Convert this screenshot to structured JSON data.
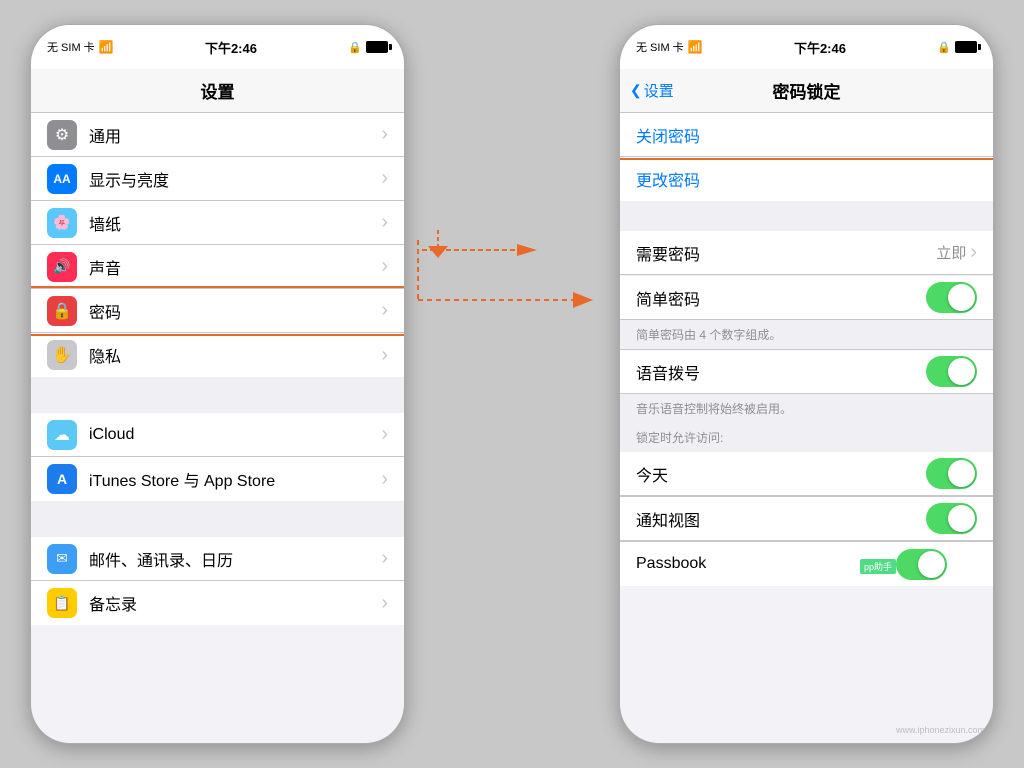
{
  "left_phone": {
    "status": {
      "signal": "无 SIM 卡",
      "wifi": "WiFi",
      "time": "下午2:46"
    },
    "nav": {
      "title": "设置"
    },
    "sections": [
      {
        "items": [
          {
            "icon": "gear",
            "icon_color": "ic-gray",
            "label": "通用",
            "id": "general"
          },
          {
            "icon": "AA",
            "icon_color": "ic-blue",
            "label": "显示与亮度",
            "id": "display"
          },
          {
            "icon": "🌸",
            "icon_color": "ic-teal",
            "label": "墙纸",
            "id": "wallpaper"
          },
          {
            "icon": "🔊",
            "icon_color": "ic-pink",
            "label": "声音",
            "id": "sound"
          },
          {
            "icon": "🔒",
            "icon_color": "ic-red",
            "label": "密码",
            "id": "passcode",
            "highlighted": true
          },
          {
            "icon": "✋",
            "icon_color": "ic-light-gray",
            "label": "隐私",
            "id": "privacy"
          }
        ]
      },
      {
        "items": [
          {
            "icon": "☁",
            "icon_color": "ic-icloud",
            "label": "iCloud",
            "id": "icloud"
          },
          {
            "icon": "A",
            "icon_color": "ic-store",
            "label": "iTunes Store 与 App Store",
            "id": "store"
          }
        ]
      },
      {
        "items": [
          {
            "icon": "✉",
            "icon_color": "ic-mail",
            "label": "邮件、通讯录、日历",
            "id": "mail"
          },
          {
            "icon": "📋",
            "icon_color": "ic-notes",
            "label": "备忘录",
            "id": "notes"
          }
        ]
      }
    ]
  },
  "right_phone": {
    "status": {
      "signal": "无 SIM 卡",
      "wifi": "WiFi",
      "time": "下午2:46"
    },
    "nav": {
      "title": "密码锁定",
      "back": "设置"
    },
    "top_section": [
      {
        "label": "关闭密码",
        "highlighted": true
      },
      {
        "label": "更改密码"
      }
    ],
    "rows": [
      {
        "type": "navigate",
        "label": "需要密码",
        "value": "立即",
        "id": "require-passcode"
      },
      {
        "type": "toggle",
        "label": "简单密码",
        "enabled": true,
        "id": "simple-passcode"
      },
      {
        "type": "sub-text",
        "text": "简单密码由 4 个数字组成。"
      },
      {
        "type": "toggle",
        "label": "语音拨号",
        "enabled": true,
        "id": "voice-dial"
      },
      {
        "type": "sub-text",
        "text": "音乐语音控制将始终被启用。"
      },
      {
        "type": "section-header",
        "text": "锁定时允许访问:"
      },
      {
        "type": "toggle",
        "label": "今天",
        "enabled": true,
        "id": "today"
      },
      {
        "type": "toggle",
        "label": "通知视图",
        "enabled": true,
        "id": "notification-view"
      },
      {
        "type": "plain",
        "label": "Passbook",
        "id": "passbook"
      }
    ]
  },
  "watermark": "pp助手",
  "watermark_url": "www.iphonezixun.com"
}
